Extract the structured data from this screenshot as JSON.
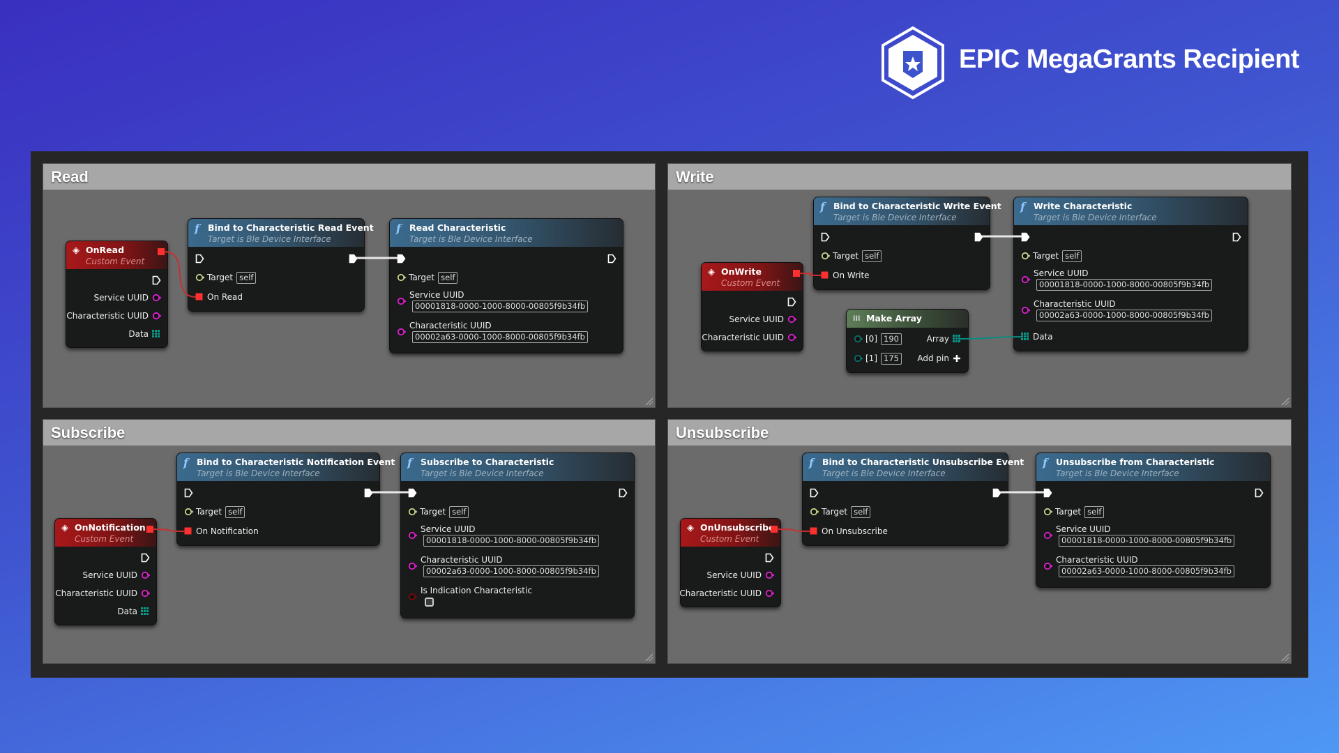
{
  "badge": {
    "text": "EPIC MegaGrants Recipient",
    "icon": "star-shield-icon"
  },
  "colors": {
    "exec": "#ffffff",
    "object": "#c8d48a",
    "string": "#e020d0",
    "delegate": "#ff3030",
    "array": "#0a9a8a",
    "wildcard": "#0d6e6a",
    "bool": "#7a0a0a"
  },
  "comments": [
    {
      "id": "read",
      "title": "Read"
    },
    {
      "id": "write",
      "title": "Write"
    },
    {
      "id": "subscribe",
      "title": "Subscribe"
    },
    {
      "id": "unsubscribe",
      "title": "Unsubscribe"
    }
  ],
  "nodes": [
    {
      "id": "onread",
      "kind": "event",
      "title": "OnRead",
      "subtitle": "Custom Event",
      "inputs": [],
      "outputs": [
        {
          "pin": "exec"
        },
        {
          "label": "Service UUID",
          "pin": "string"
        },
        {
          "label": "Characteristic UUID",
          "pin": "string"
        },
        {
          "label": "Data",
          "pin": "array"
        }
      ]
    },
    {
      "id": "bindread",
      "kind": "function",
      "title": "Bind to Characteristic Read Event",
      "subtitle": "Target is Ble Device Interface",
      "inputs": [
        {
          "pin": "exec"
        },
        {
          "label": "Target",
          "pin": "object",
          "value": "self"
        },
        {
          "label": "On Read",
          "pin": "delegate"
        }
      ],
      "outputs": [
        {
          "pin": "exec"
        }
      ]
    },
    {
      "id": "readchar",
      "kind": "function",
      "title": "Read Characteristic",
      "subtitle": "Target is Ble Device Interface",
      "inputs": [
        {
          "pin": "exec"
        },
        {
          "label": "Target",
          "pin": "object",
          "value": "self"
        },
        {
          "label": "Service UUID",
          "pin": "string",
          "value": "00001818-0000-1000-8000-00805f9b34fb"
        },
        {
          "label": "Characteristic UUID",
          "pin": "string",
          "value": "00002a63-0000-1000-8000-00805f9b34fb"
        }
      ],
      "outputs": [
        {
          "pin": "exec"
        }
      ]
    },
    {
      "id": "onwrite",
      "kind": "event",
      "title": "OnWrite",
      "subtitle": "Custom Event",
      "inputs": [],
      "outputs": [
        {
          "pin": "exec"
        },
        {
          "label": "Service UUID",
          "pin": "string"
        },
        {
          "label": "Characteristic UUID",
          "pin": "string"
        }
      ]
    },
    {
      "id": "bindwrite",
      "kind": "function",
      "title": "Bind to Characteristic Write Event",
      "subtitle": "Target is Ble Device Interface",
      "inputs": [
        {
          "pin": "exec"
        },
        {
          "label": "Target",
          "pin": "object",
          "value": "self"
        },
        {
          "label": "On Write",
          "pin": "delegate"
        }
      ],
      "outputs": [
        {
          "pin": "exec"
        }
      ]
    },
    {
      "id": "makearray",
      "kind": "make_array",
      "title": "Make Array",
      "inputs": [
        {
          "label": "[0]",
          "pin": "wildcard",
          "value": "190"
        },
        {
          "label": "[1]",
          "pin": "wildcard",
          "value": "175"
        }
      ],
      "outputs": [
        {
          "label": "Array",
          "pin": "array"
        },
        {
          "label": "Add pin",
          "pin": "add"
        }
      ]
    },
    {
      "id": "writechar",
      "kind": "function",
      "title": "Write Characteristic",
      "subtitle": "Target is Ble Device Interface",
      "inputs": [
        {
          "pin": "exec"
        },
        {
          "label": "Target",
          "pin": "object",
          "value": "self"
        },
        {
          "label": "Service UUID",
          "pin": "string",
          "value": "00001818-0000-1000-8000-00805f9b34fb"
        },
        {
          "label": "Characteristic UUID",
          "pin": "string",
          "value": "00002a63-0000-1000-8000-00805f9b34fb"
        },
        {
          "label": "Data",
          "pin": "array"
        }
      ],
      "outputs": [
        {
          "pin": "exec"
        }
      ]
    },
    {
      "id": "onnotif",
      "kind": "event",
      "title": "OnNotification",
      "subtitle": "Custom Event",
      "inputs": [],
      "outputs": [
        {
          "pin": "exec"
        },
        {
          "label": "Service UUID",
          "pin": "string"
        },
        {
          "label": "Characteristic UUID",
          "pin": "string"
        },
        {
          "label": "Data",
          "pin": "array"
        }
      ]
    },
    {
      "id": "bindnotif",
      "kind": "function",
      "title": "Bind to Characteristic Notification Event",
      "subtitle": "Target is Ble Device Interface",
      "inputs": [
        {
          "pin": "exec"
        },
        {
          "label": "Target",
          "pin": "object",
          "value": "self"
        },
        {
          "label": "On Notification",
          "pin": "delegate"
        }
      ],
      "outputs": [
        {
          "pin": "exec"
        }
      ]
    },
    {
      "id": "subchar",
      "kind": "function",
      "title": "Subscribe to Characteristic",
      "subtitle": "Target is Ble Device Interface",
      "inputs": [
        {
          "pin": "exec"
        },
        {
          "label": "Target",
          "pin": "object",
          "value": "self"
        },
        {
          "label": "Service UUID",
          "pin": "string",
          "value": "00001818-0000-1000-8000-00805f9b34fb"
        },
        {
          "label": "Characteristic UUID",
          "pin": "string",
          "value": "00002a63-0000-1000-8000-00805f9b34fb"
        },
        {
          "label": "Is Indication Characteristic",
          "pin": "bool",
          "checked": false
        }
      ],
      "outputs": [
        {
          "pin": "exec"
        }
      ]
    },
    {
      "id": "onunsub",
      "kind": "event",
      "title": "OnUnsubscribe",
      "subtitle": "Custom Event",
      "inputs": [],
      "outputs": [
        {
          "pin": "exec"
        },
        {
          "label": "Service UUID",
          "pin": "string"
        },
        {
          "label": "Characteristic UUID",
          "pin": "string"
        }
      ]
    },
    {
      "id": "bindunsub",
      "kind": "function",
      "title": "Bind to Characteristic Unsubscribe Event",
      "subtitle": "Target is Ble Device Interface",
      "inputs": [
        {
          "pin": "exec"
        },
        {
          "label": "Target",
          "pin": "object",
          "value": "self"
        },
        {
          "label": "On Unsubscribe",
          "pin": "delegate"
        }
      ],
      "outputs": [
        {
          "pin": "exec"
        }
      ]
    },
    {
      "id": "unsubchar",
      "kind": "function",
      "title": "Unsubscribe from Characteristic",
      "subtitle": "Target is Ble Device Interface",
      "inputs": [
        {
          "pin": "exec"
        },
        {
          "label": "Target",
          "pin": "object",
          "value": "self"
        },
        {
          "label": "Service UUID",
          "pin": "string",
          "value": "00001818-0000-1000-8000-00805f9b34fb"
        },
        {
          "label": "Characteristic UUID",
          "pin": "string",
          "value": "00002a63-0000-1000-8000-00805f9b34fb"
        }
      ],
      "outputs": [
        {
          "pin": "exec"
        }
      ]
    }
  ],
  "links": [
    {
      "from": "onread.delegate",
      "to": "bindread.in.2",
      "type": "delegate"
    },
    {
      "from": "bindread.out.0",
      "to": "readchar.in.0",
      "type": "exec"
    },
    {
      "from": "onwrite.delegate",
      "to": "bindwrite.in.2",
      "type": "delegate"
    },
    {
      "from": "bindwrite.out.0",
      "to": "writechar.in.0",
      "type": "exec"
    },
    {
      "from": "makearray.out.0",
      "to": "writechar.in.4",
      "type": "array"
    },
    {
      "from": "onnotif.delegate",
      "to": "bindnotif.in.2",
      "type": "delegate"
    },
    {
      "from": "bindnotif.out.0",
      "to": "subchar.in.0",
      "type": "exec"
    },
    {
      "from": "onunsub.delegate",
      "to": "bindunsub.in.2",
      "type": "delegate"
    },
    {
      "from": "bindunsub.out.0",
      "to": "unsubchar.in.0",
      "type": "exec"
    }
  ]
}
